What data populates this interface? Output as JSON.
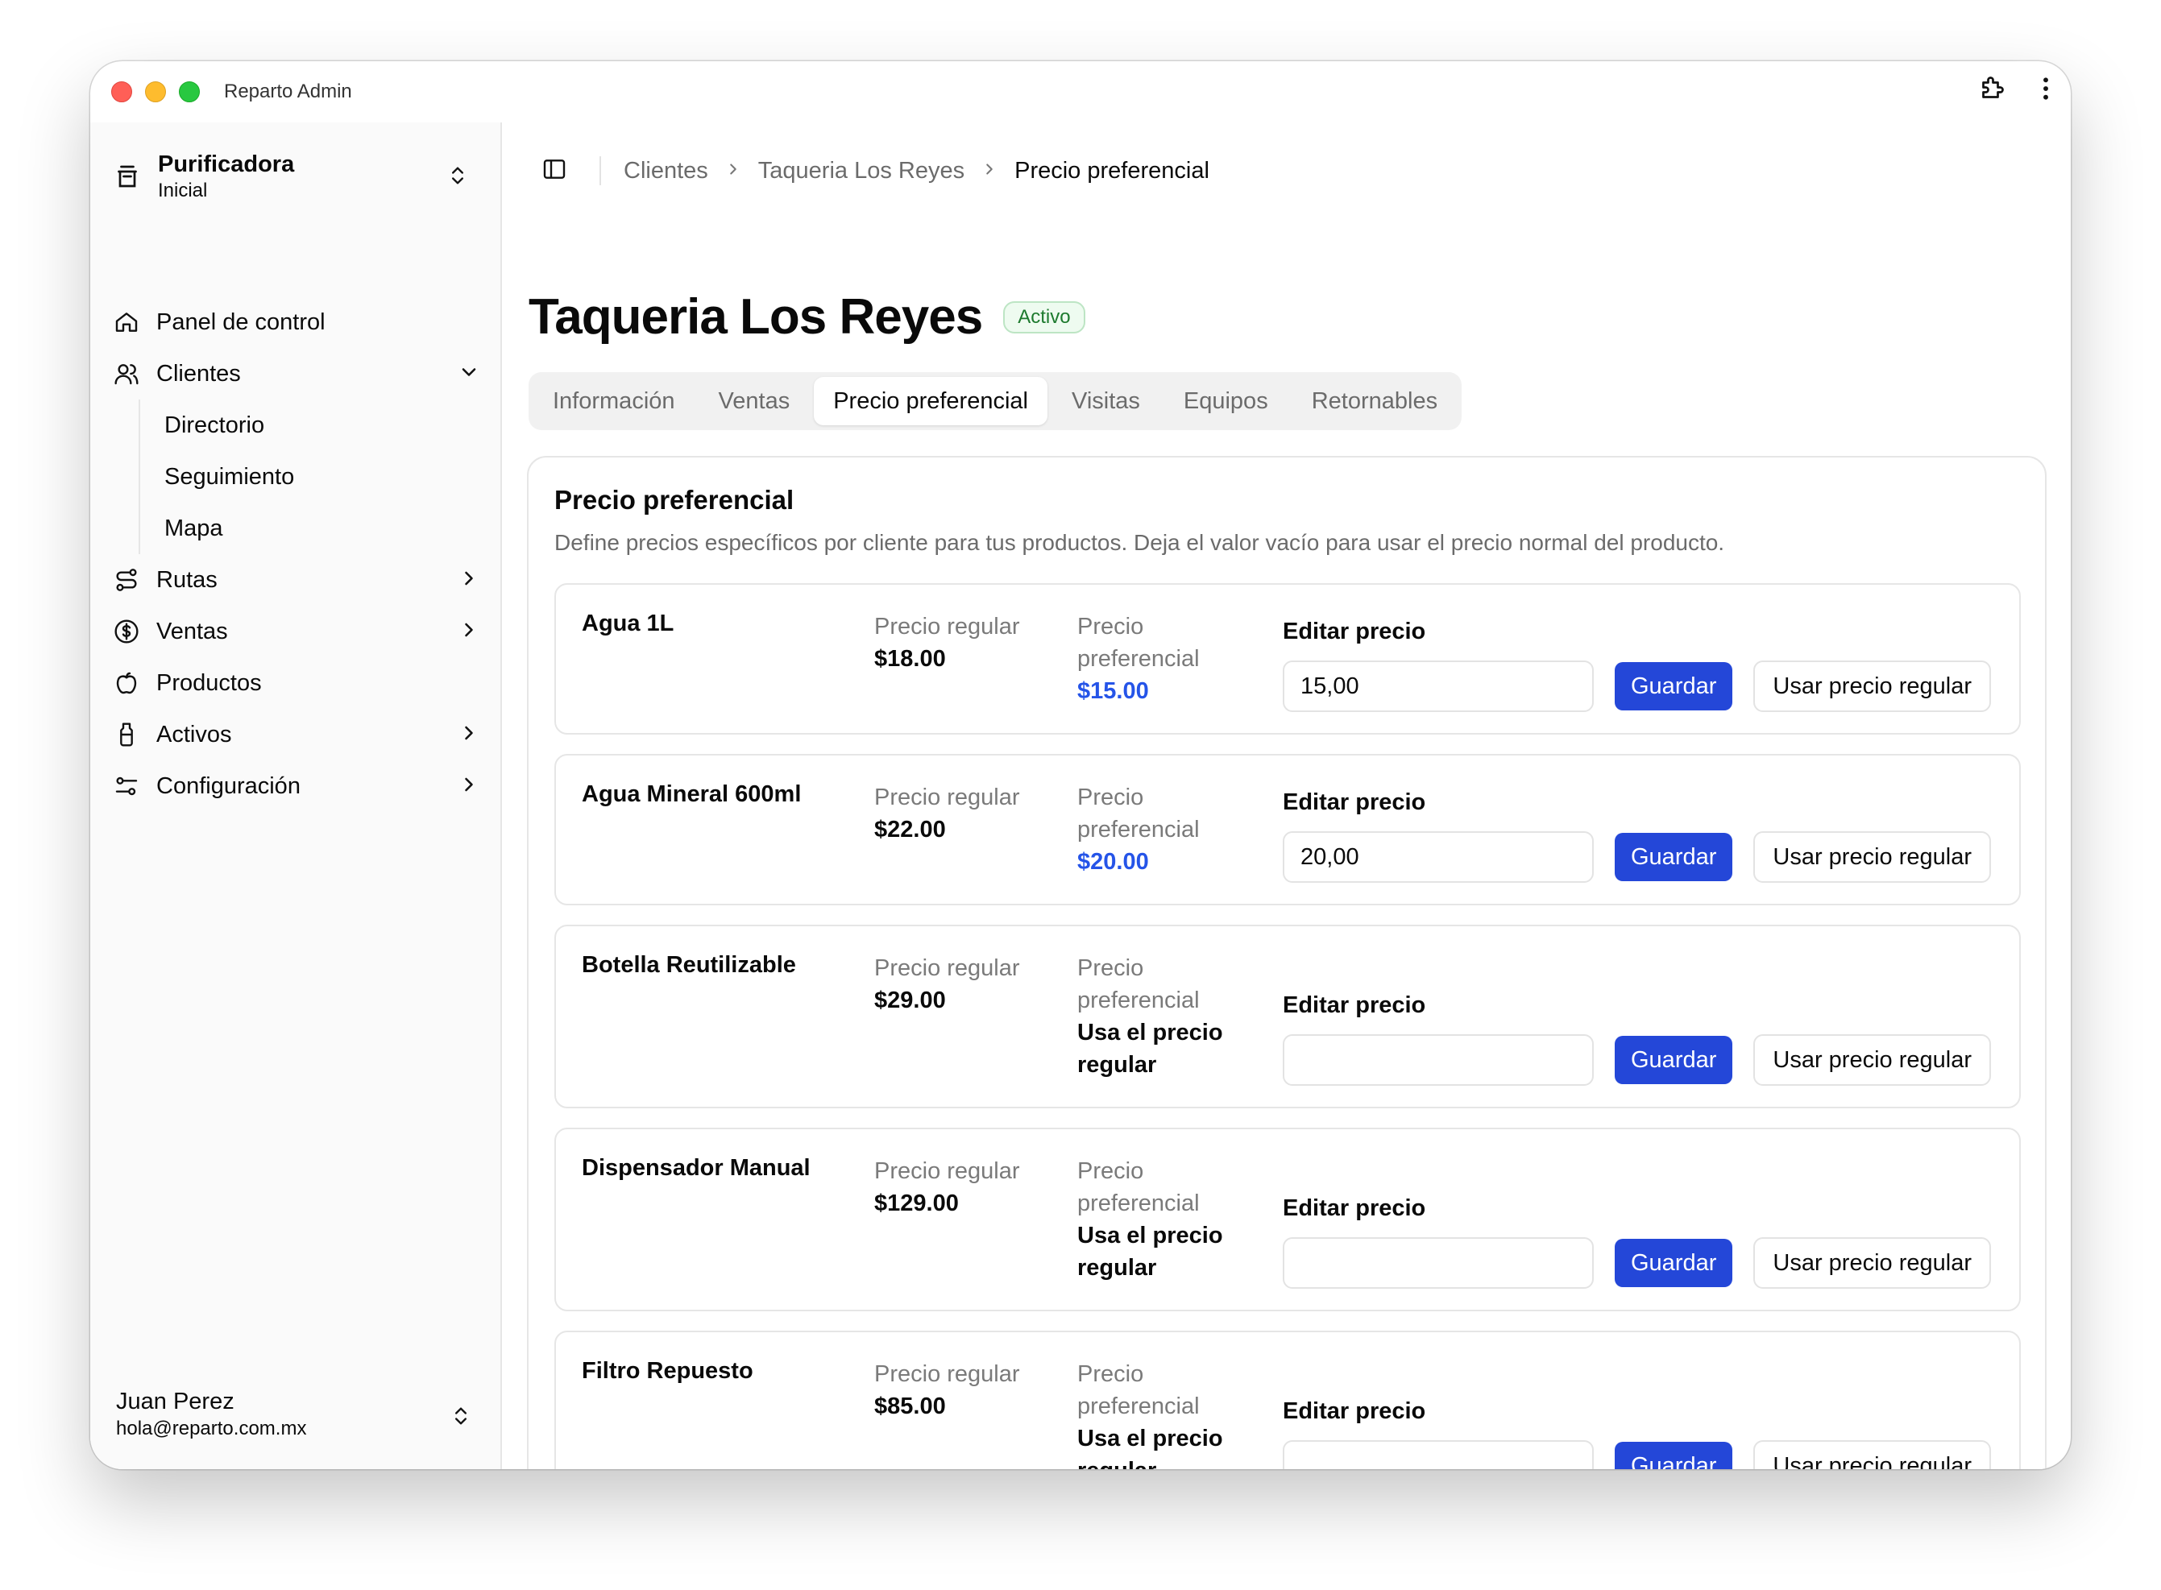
{
  "window": {
    "title": "Reparto Admin"
  },
  "sidebar": {
    "org": {
      "name": "Purificadora",
      "plan": "Inicial"
    },
    "items": [
      {
        "label": "Panel de control",
        "icon": "home-icon"
      },
      {
        "label": "Clientes",
        "icon": "users-icon",
        "expanded": true,
        "children": [
          {
            "label": "Directorio"
          },
          {
            "label": "Seguimiento"
          },
          {
            "label": "Mapa"
          }
        ]
      },
      {
        "label": "Rutas",
        "icon": "route-icon"
      },
      {
        "label": "Ventas",
        "icon": "dollar-icon"
      },
      {
        "label": "Productos",
        "icon": "apple-icon"
      },
      {
        "label": "Activos",
        "icon": "bottle-icon"
      },
      {
        "label": "Configuración",
        "icon": "settings-icon"
      }
    ],
    "user": {
      "name": "Juan Perez",
      "email": "hola@reparto.com.mx"
    }
  },
  "breadcrumb": {
    "items": [
      "Clientes",
      "Taqueria Los Reyes",
      "Precio preferencial"
    ]
  },
  "page": {
    "title": "Taqueria Los Reyes",
    "status": "Activo"
  },
  "tabs": [
    "Información",
    "Ventas",
    "Precio preferencial",
    "Visitas",
    "Equipos",
    "Retornables"
  ],
  "active_tab": "Precio preferencial",
  "card": {
    "title": "Precio preferencial",
    "description": "Define precios específicos por cliente para tus productos. Deja el valor vacío para usar el precio normal del producto."
  },
  "labels": {
    "regular": "Precio regular",
    "preferential_1": "Precio",
    "preferential_2": "preferencial",
    "edit": "Editar precio",
    "save": "Guardar",
    "use_regular": "Usar precio regular"
  },
  "products": [
    {
      "name": "Agua 1L",
      "regular": "$18.00",
      "preferential": "$15.00",
      "input": "15,00"
    },
    {
      "name": "Agua Mineral 600ml",
      "regular": "$22.00",
      "preferential": "$20.00",
      "input": "20,00"
    },
    {
      "name": "Botella Reutilizable",
      "regular": "$29.00",
      "preferential": "Usa el precio regular",
      "input": ""
    },
    {
      "name": "Dispensador Manual",
      "regular": "$129.00",
      "preferential": "Usa el precio regular",
      "input": ""
    },
    {
      "name": "Filtro Repuesto",
      "regular": "$85.00",
      "preferential": "Usa el precio regular",
      "input": ""
    }
  ],
  "colors": {
    "accent": "#2447d8",
    "preferential_text": "#2554e8",
    "active_badge": "#1d7a2e"
  }
}
